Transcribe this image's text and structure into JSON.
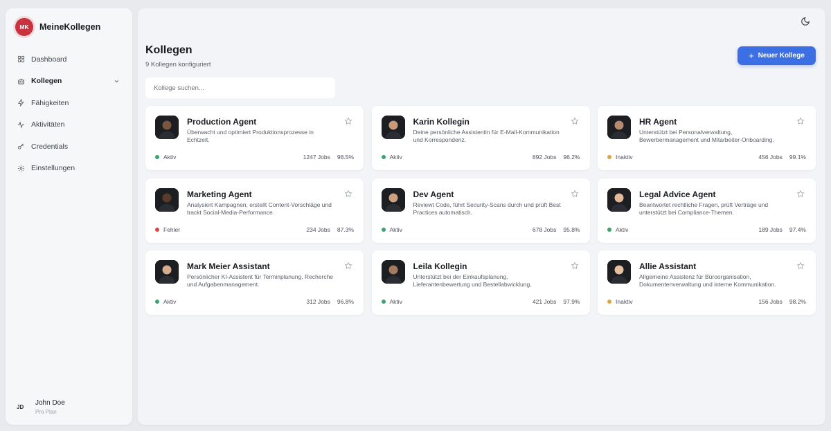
{
  "brand": {
    "initials": "MK",
    "name": "MeineKollegen"
  },
  "nav": [
    {
      "label": "Dashboard",
      "icon": "grid-icon"
    },
    {
      "label": "Kollegen",
      "icon": "bot-icon",
      "active": true,
      "expandable": true
    },
    {
      "label": "Fähigkeiten",
      "icon": "zap-icon"
    },
    {
      "label": "Aktivitäten",
      "icon": "activity-icon"
    },
    {
      "label": "Credentials",
      "icon": "key-icon"
    },
    {
      "label": "Einstellungen",
      "icon": "gear-icon"
    }
  ],
  "user": {
    "initials": "JD",
    "name": "John Doe",
    "plan": "Pro Plan"
  },
  "header": {
    "title": "Kollegen",
    "subtitle": "9 Kollegen konfiguriert",
    "new_button": "Neuer Kollege",
    "search_placeholder": "Kollege suchen..."
  },
  "colors": {
    "accent": "#3b6fe3",
    "brand": "#c8333f",
    "status_active": "#3aa46b",
    "status_inactive": "#e0a340",
    "status_error": "#d9473f"
  },
  "agents": [
    {
      "name": "Production Agent",
      "description": "Überwacht und optimiert Produktionsprozesse in Echtzeit.",
      "status": "Aktiv",
      "status_key": "active",
      "jobs": "1247 Jobs",
      "rate": "98.5%"
    },
    {
      "name": "Karin Kollegin",
      "description": "Deine persönliche Assistentin für E-Mail-Kommunikation und Korrespondenz.",
      "status": "Aktiv",
      "status_key": "active",
      "jobs": "892 Jobs",
      "rate": "96.2%"
    },
    {
      "name": "HR Agent",
      "description": "Unterstützt bei Personalverwaltung, Bewerbermanagement und Mitarbeiter-Onboarding.",
      "status": "Inaktiv",
      "status_key": "inactive",
      "jobs": "456 Jobs",
      "rate": "99.1%"
    },
    {
      "name": "Marketing Agent",
      "description": "Analysiert Kampagnen, erstellt Content-Vorschläge und trackt Social-Media-Performance.",
      "status": "Fehler",
      "status_key": "error",
      "jobs": "234 Jobs",
      "rate": "87.3%"
    },
    {
      "name": "Dev Agent",
      "description": "Reviewt Code, führt Security-Scans durch und prüft Best Practices automatisch.",
      "status": "Aktiv",
      "status_key": "active",
      "jobs": "678 Jobs",
      "rate": "95.8%"
    },
    {
      "name": "Legal Advice Agent",
      "description": "Beantwortet rechtliche Fragen, prüft Verträge und unterstützt bei Compliance-Themen.",
      "status": "Aktiv",
      "status_key": "active",
      "jobs": "189 Jobs",
      "rate": "97.4%"
    },
    {
      "name": "Mark Meier Assistant",
      "description": "Persönlicher KI-Assistent für Terminplanung, Recherche und Aufgabenmanagement.",
      "status": "Aktiv",
      "status_key": "active",
      "jobs": "312 Jobs",
      "rate": "96.8%"
    },
    {
      "name": "Leila Kollegin",
      "description": "Unterstützt bei der Einkaufsplanung, Lieferantenbewertung und Bestellabwicklung.",
      "status": "Aktiv",
      "status_key": "active",
      "jobs": "421 Jobs",
      "rate": "97.9%"
    },
    {
      "name": "Allie Assistant",
      "description": "Allgemeine Assistenz für Büroorganisation, Dokumentenverwaltung und interne Kommunikation.",
      "status": "Inaktiv",
      "status_key": "inactive",
      "jobs": "156 Jobs",
      "rate": "98.2%"
    }
  ]
}
